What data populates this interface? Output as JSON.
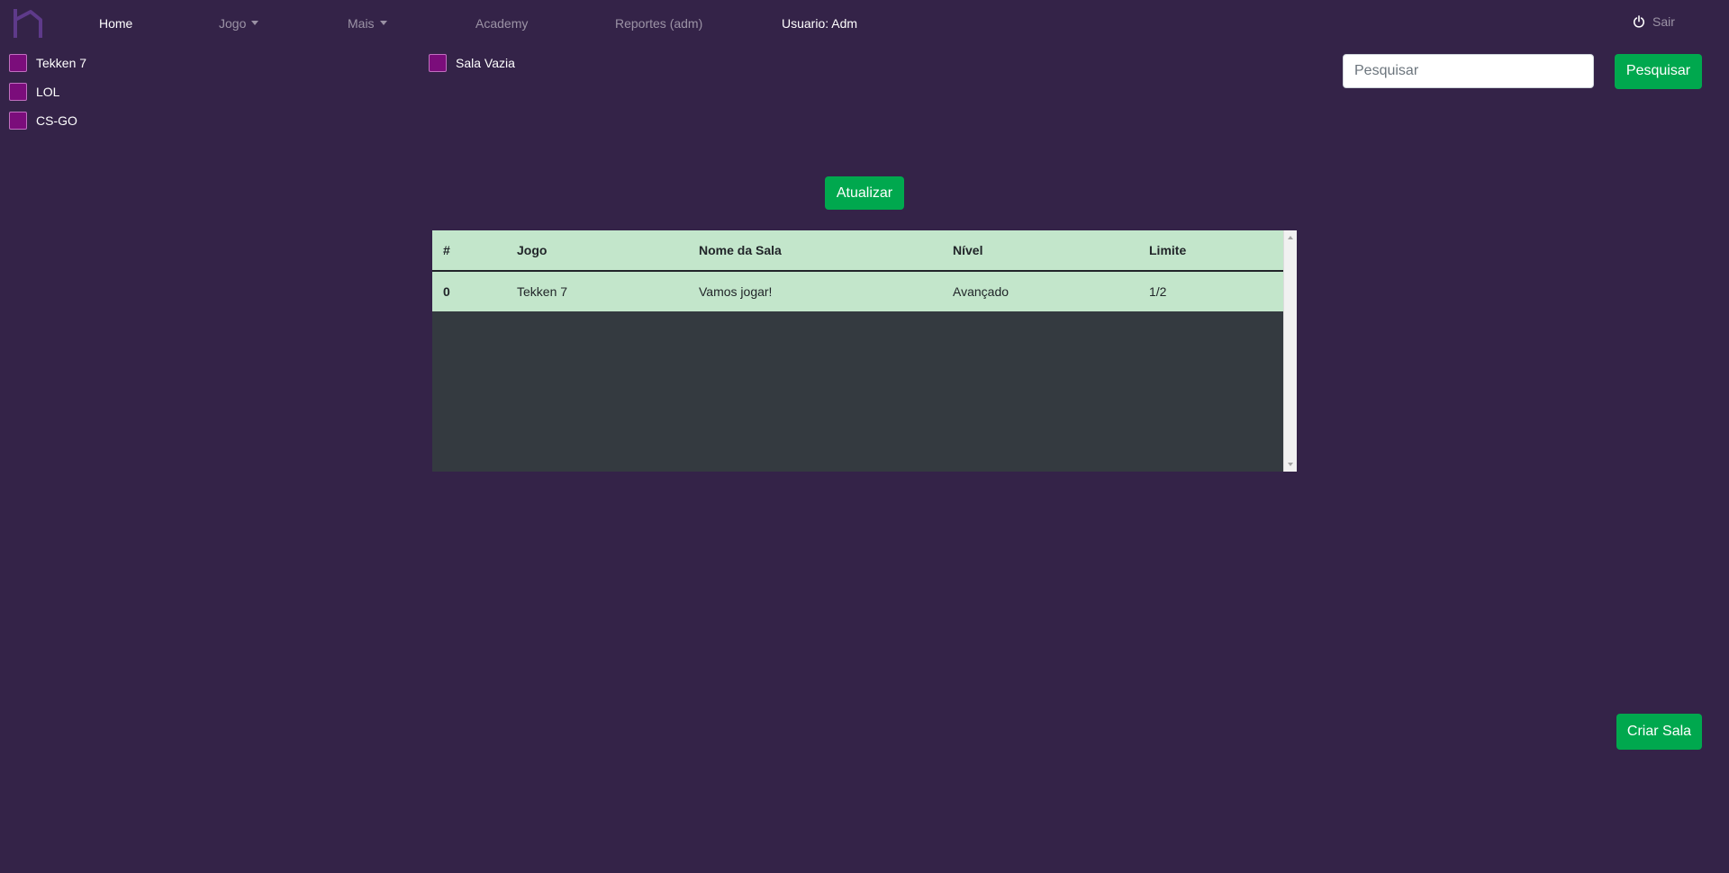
{
  "navbar": {
    "logo_icon": "brand-logo-icon",
    "items": [
      {
        "label": "Home"
      },
      {
        "label": "Jogo"
      },
      {
        "label": "Mais"
      },
      {
        "label": "Academy"
      },
      {
        "label": "Reportes (adm)"
      }
    ],
    "user_label": "Usuario: Adm",
    "logout_label": "Sair",
    "logout_icon": "power-icon"
  },
  "filters": {
    "games": [
      {
        "label": "Tekken 7"
      },
      {
        "label": "LOL"
      },
      {
        "label": "CS-GO"
      }
    ],
    "empty_room": {
      "label": "Sala Vazia"
    },
    "checkbox_color": "#7b0d7b"
  },
  "search": {
    "placeholder": "Pesquisar",
    "value": "",
    "button_label": "Pesquisar"
  },
  "refresh_label": "Atualizar",
  "table": {
    "columns": [
      "#",
      "Jogo",
      "Nome da Sala",
      "Nível",
      "Limite"
    ],
    "rows": [
      {
        "idx": "0",
        "game": "Tekken 7",
        "room": "Vamos jogar!",
        "level": "Avançado",
        "limit": "1/2"
      }
    ]
  },
  "create_room_label": "Criar Sala",
  "colors": {
    "background": "#342348",
    "accent_green": "#00a84e",
    "row_green": "#c3e6cb"
  }
}
